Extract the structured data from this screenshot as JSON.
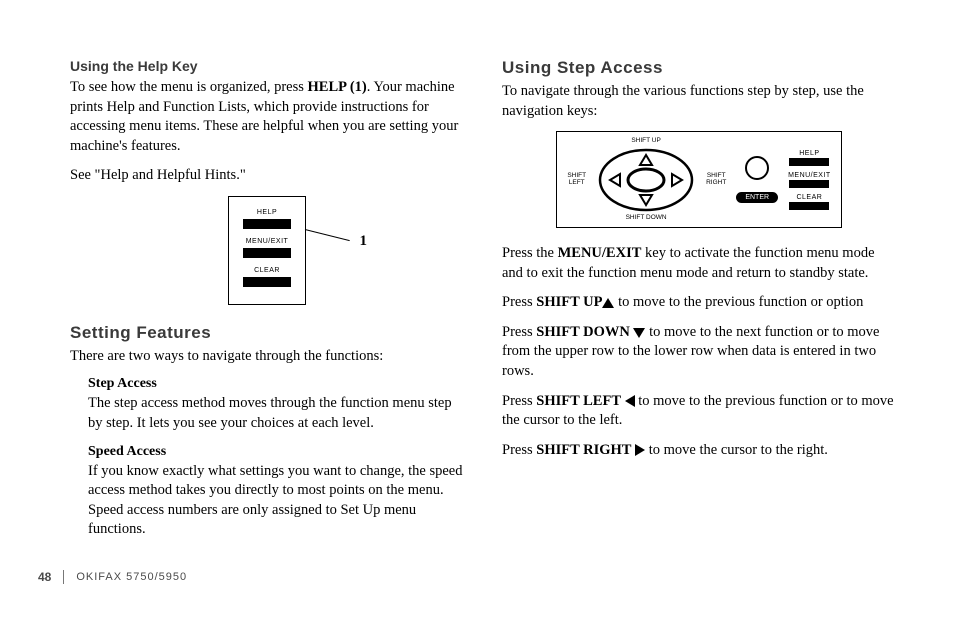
{
  "left": {
    "help_heading": "Using the Help Key",
    "help_p1a": "To see how the menu is organized, press ",
    "help_p1b": "HELP (1)",
    "help_p1c": ". Your machine prints Help and Function Lists, which provide instructions for accessing menu items. These are helpful when you are setting your machine's features.",
    "help_p2": "See \"Help and Helpful Hints.\"",
    "fig1_help": "HELP",
    "fig1_menu": "MENU/EXIT",
    "fig1_clear": "CLEAR",
    "fig1_callout": "1",
    "setting_heading": "Setting  Features",
    "setting_intro": "There are two ways to navigate through the functions:",
    "step_label": "Step Access",
    "step_text": "The step access method moves through the function menu step by step. It lets you see your choices at each level.",
    "speed_label": "Speed Access",
    "speed_text": "If you know exactly what settings you want to change, the speed access method takes you directly to most points on the menu. Speed access numbers are only assigned to Set Up menu functions."
  },
  "right": {
    "heading": "Using  Step  Access",
    "intro": "To navigate through the various functions step by step, use the navigation keys:",
    "fig2": {
      "shift_up": "SHIFT UP",
      "shift_down": "SHIFT DOWN",
      "shift_left": "SHIFT\nLEFT",
      "shift_right": "SHIFT\nRIGHT",
      "help": "HELP",
      "menu": "MENU/EXIT",
      "clear": "CLEAR",
      "enter": "ENTER"
    },
    "p1a": "Press the ",
    "p1b": "MENU/EXIT",
    "p1c": " key to activate the function menu mode and to exit the function menu mode and return to standby state.",
    "p2a": "Press ",
    "p2b": "SHIFT UP",
    "p2c": " to move to the previous function or option",
    "p3a": "Press ",
    "p3b": "SHIFT DOWN",
    "p3c": " to move to the next function or to move from the upper row to the lower row when data is entered in two rows.",
    "p4a": "Press ",
    "p4b": "SHIFT LEFT",
    "p4c": " to move to the previous function or to move the cursor to the left.",
    "p5a": "Press ",
    "p5b": "SHIFT RIGHT",
    "p5c": " to move the cursor to the right."
  },
  "footer": {
    "page": "48",
    "model": "OKIFAX 5750/5950"
  }
}
